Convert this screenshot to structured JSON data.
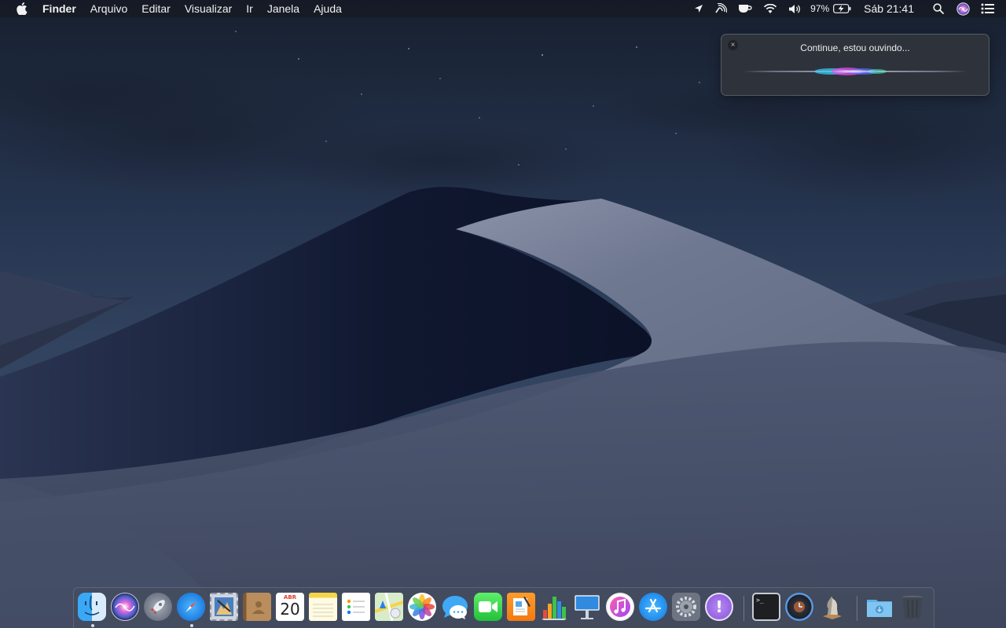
{
  "menubar": {
    "apple_icon": "apple-logo",
    "app_name": "Finder",
    "menus": [
      "Arquivo",
      "Editar",
      "Visualizar",
      "Ir",
      "Janela",
      "Ajuda"
    ],
    "status": {
      "battery_percent": "97%",
      "clock": "Sáb 21:41"
    }
  },
  "siri": {
    "prompt": "Continue, estou ouvindo...",
    "close_symbol": "×"
  },
  "dock": {
    "apps": [
      {
        "name": "Finder",
        "running": true
      },
      {
        "name": "Siri"
      },
      {
        "name": "Launchpad"
      },
      {
        "name": "Safari",
        "running": true
      },
      {
        "name": "Mail"
      },
      {
        "name": "Contatos"
      },
      {
        "name": "Calendário",
        "month": "ABR",
        "day": "20"
      },
      {
        "name": "Notas"
      },
      {
        "name": "Lembretes"
      },
      {
        "name": "Mapas"
      },
      {
        "name": "Fotos"
      },
      {
        "name": "Mensagens"
      },
      {
        "name": "FaceTime"
      },
      {
        "name": "Pages"
      },
      {
        "name": "Numbers"
      },
      {
        "name": "Keynote"
      },
      {
        "name": "iTunes"
      },
      {
        "name": "App Store"
      },
      {
        "name": "Preferências do Sistema"
      },
      {
        "name": "Feedback Assistant"
      },
      {
        "name": "Terminal"
      },
      {
        "name": "Time Machine"
      },
      {
        "name": "Xadrez"
      },
      {
        "name": "Downloads"
      },
      {
        "name": "Lixo"
      }
    ],
    "terminal_prompt": ">_"
  },
  "colors": {
    "menubar_bg": "#161a24",
    "siri_bg": "#30343c",
    "sky": "#24314a",
    "dune_light": "#8c95ab",
    "dune_shadow": "#141c33"
  }
}
